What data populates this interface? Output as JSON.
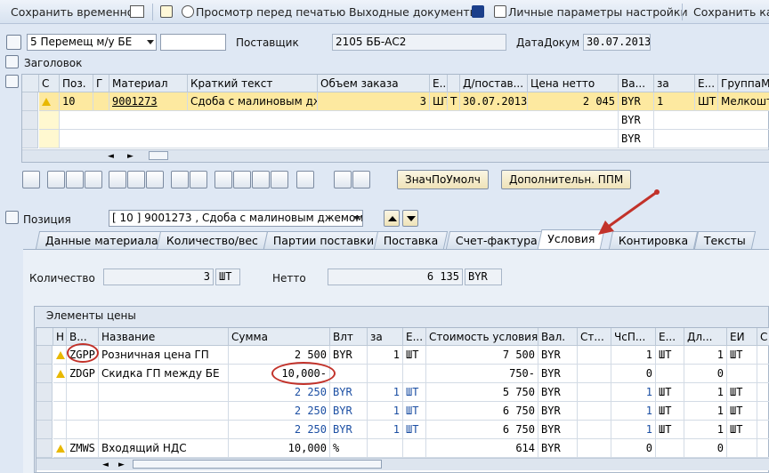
{
  "toolbar": {
    "save_temp": "Сохранить временно",
    "print_preview": "Просмотр перед печатью",
    "output": "Выходные документы",
    "personal": "Личные параметры настройки",
    "save_as": "Сохранить как"
  },
  "header": {
    "doc_type": "5 Перемещ м/у БЕ",
    "supplier_label": "Поставщик",
    "supplier": "2105 ББ-АС2",
    "date_label": "ДатаДокум",
    "date": "30.07.2013",
    "title_section": "Заголовок"
  },
  "items": {
    "columns": [
      "С",
      "Поз.",
      "Г",
      "Материал",
      "Краткий текст",
      "Объем заказа",
      "Е...",
      "",
      "Д/постав...",
      "Цена нетто",
      "Ва...",
      "за",
      "Е...",
      "ГруппаМт"
    ],
    "row": {
      "pos": "10",
      "material": "9001273",
      "text": "Сдоба с малиновым дж...",
      "qty": "3",
      "unit": "ШТ",
      "cat": "T",
      "date": "30.07.2013",
      "price": "2 045",
      "cur": "BYR",
      "per": "1",
      "unit2": "ШТ",
      "group": "Мелкоштучн"
    },
    "empty_cur": [
      "BYR",
      "BYR"
    ]
  },
  "buttons": {
    "defaults": "ЗначПоУмолч",
    "additional": "Дополнительн. ППМ"
  },
  "position": {
    "label": "Позиция",
    "value": "[ 10 ] 9001273 , Сдоба с малиновым джемом"
  },
  "tabs": [
    "Данные материала",
    "Количество/вес",
    "Партии поставки",
    "Поставка",
    "Счет-фактура",
    "Условия",
    "Контировка",
    "Тексты"
  ],
  "conditions": {
    "qty_label": "Количество",
    "qty": "3",
    "qty_unit": "ШТ",
    "net_label": "Нетто",
    "net": "6 135",
    "net_cur": "BYR",
    "section": "Элементы цены",
    "columns": [
      "Н",
      "В...",
      "Название",
      "Сумма",
      "Влт",
      "за",
      "Е...",
      "Стоимость условия",
      "Вал.",
      "Ст...",
      "ЧсП...",
      "Е...",
      "Дл...",
      "ЕИ",
      "С"
    ],
    "rows": [
      {
        "warn": true,
        "type": "ZGPP",
        "name": "Розничная цена ГП",
        "amount": "2 500",
        "cur": "BYR",
        "per": "1",
        "unit": "ШТ",
        "value": "7 500",
        "vcur": "BYR",
        "num": "1",
        "u2": "ШТ",
        "den": "1",
        "ei": "ШТ",
        "blue": false
      },
      {
        "warn": true,
        "type": "ZDGP",
        "name": "Скидка ГП между БЕ",
        "amount": "10,000-",
        "cur": "",
        "per": "",
        "unit": "",
        "value": "750-",
        "vcur": "BYR",
        "num": "0",
        "u2": "",
        "den": "0",
        "ei": "",
        "blue": false
      },
      {
        "warn": false,
        "type": "",
        "name": "",
        "amount": "2 250",
        "cur": "BYR",
        "per": "1",
        "unit": "ШТ",
        "value": "5 750",
        "vcur": "BYR",
        "num": "1",
        "u2": "ШТ",
        "den": "1",
        "ei": "ШТ",
        "blue": true
      },
      {
        "warn": false,
        "type": "",
        "name": "",
        "amount": "2 250",
        "cur": "BYR",
        "per": "1",
        "unit": "ШТ",
        "value": "6 750",
        "vcur": "BYR",
        "num": "1",
        "u2": "ШТ",
        "den": "1",
        "ei": "ШТ",
        "blue": true
      },
      {
        "warn": false,
        "type": "",
        "name": "",
        "amount": "2 250",
        "cur": "BYR",
        "per": "1",
        "unit": "ШТ",
        "value": "6 750",
        "vcur": "BYR",
        "num": "1",
        "u2": "ШТ",
        "den": "1",
        "ei": "ШТ",
        "blue": true
      },
      {
        "warn": true,
        "type": "ZMWS",
        "name": "Входящий НДС",
        "amount": "10,000",
        "cur": "%",
        "per": "",
        "unit": "",
        "value": "614",
        "vcur": "BYR",
        "num": "0",
        "u2": "",
        "den": "0",
        "ei": "",
        "blue": false
      }
    ]
  },
  "colors": {
    "accent_arrow": "#c2322a",
    "selected_row": "#fde9a0"
  }
}
